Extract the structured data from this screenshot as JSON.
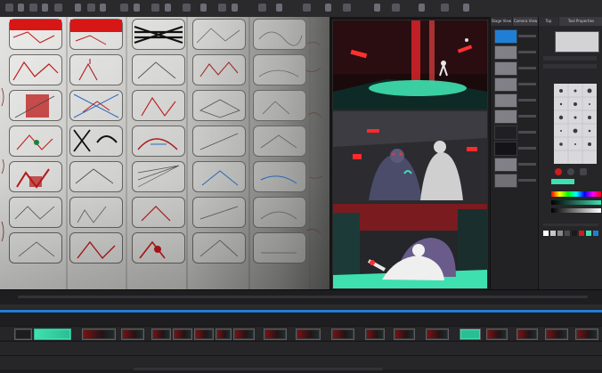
{
  "app": {
    "panels": {
      "middle_tab_1": "Stage View",
      "middle_tab_2": "Camera View",
      "right_tab_1": "Top",
      "right_tab_2": "Tool Properties"
    }
  },
  "colors": {
    "accent_red": "#cc1c1c",
    "accent_green": "#3fe0b0",
    "accent_blue": "#1f7fd6",
    "panel_bg": "#262629"
  },
  "timeline": {
    "track_count": 4
  }
}
